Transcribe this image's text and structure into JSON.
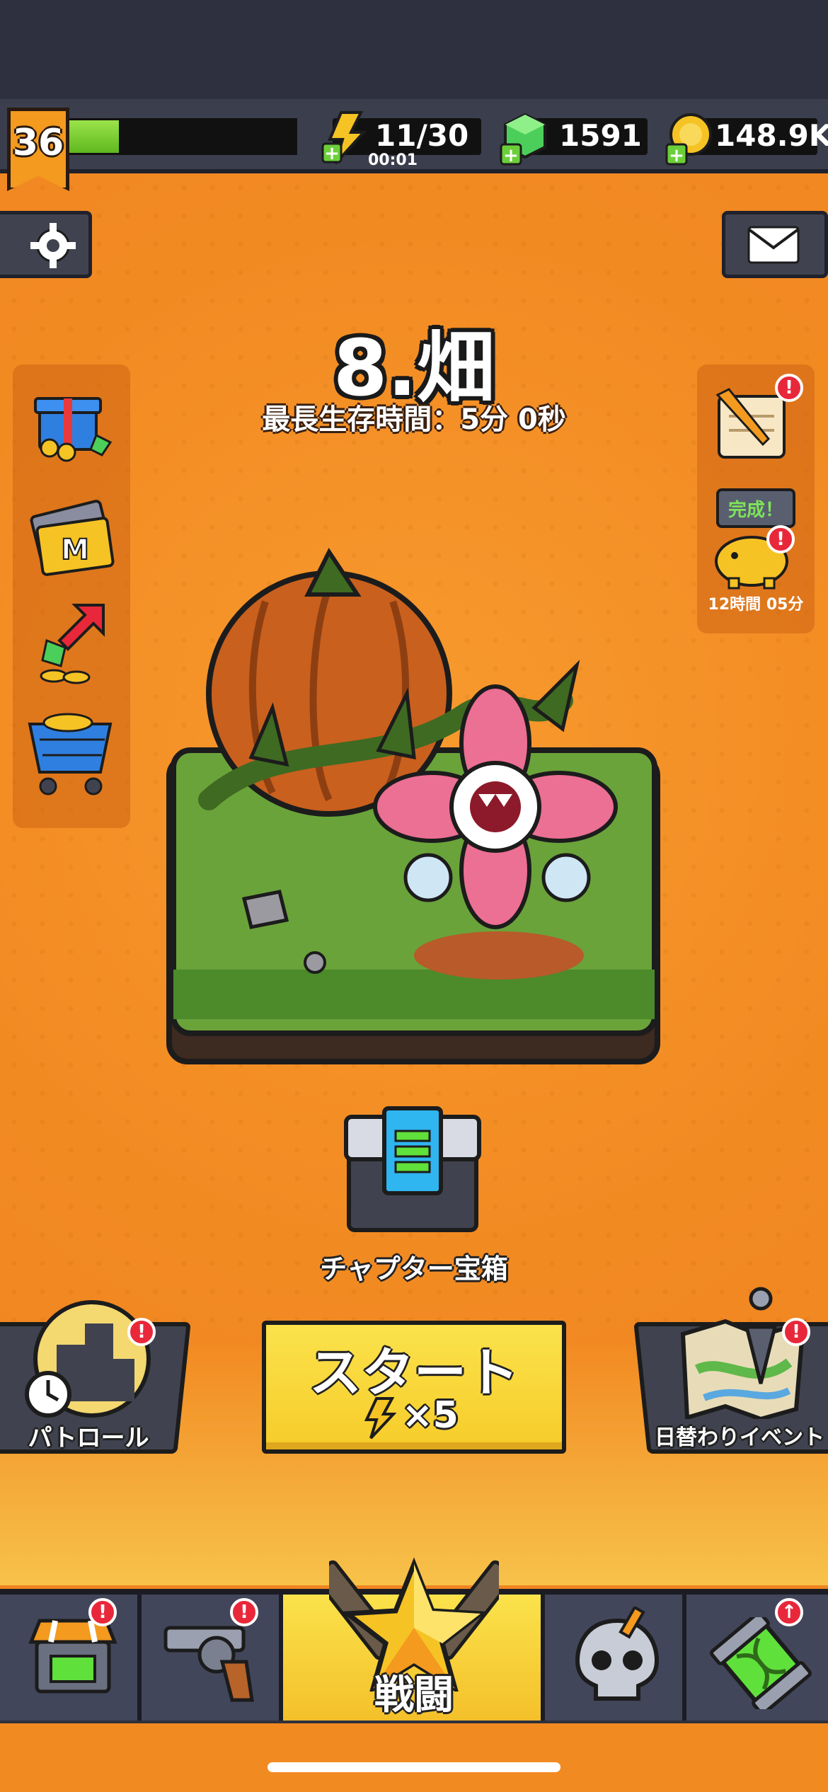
{
  "top": {
    "level": "36",
    "xp_progress": 0.22,
    "energy": "11/30",
    "energy_timer": "00:01",
    "gems": "1591",
    "coins": "148.9K"
  },
  "stage": {
    "title": "8.畑",
    "best_survival": "最長生存時間：5分 0秒"
  },
  "right_panel": {
    "complete_label": "完成！",
    "piggy_timer": "12時間 05分"
  },
  "chest": {
    "label": "チャプター宝箱"
  },
  "buttons": {
    "patrol_label": "パトロール",
    "daily_event_label": "日替わりイベント",
    "start_label": "スタート",
    "start_cost": "×5"
  },
  "nav": {
    "battle_label": "戦闘"
  },
  "colors": {
    "background": "#f28a22",
    "start_button": "#fbe24b",
    "alert_badge": "#e8283a",
    "xp_fill": "#7ccf34"
  }
}
